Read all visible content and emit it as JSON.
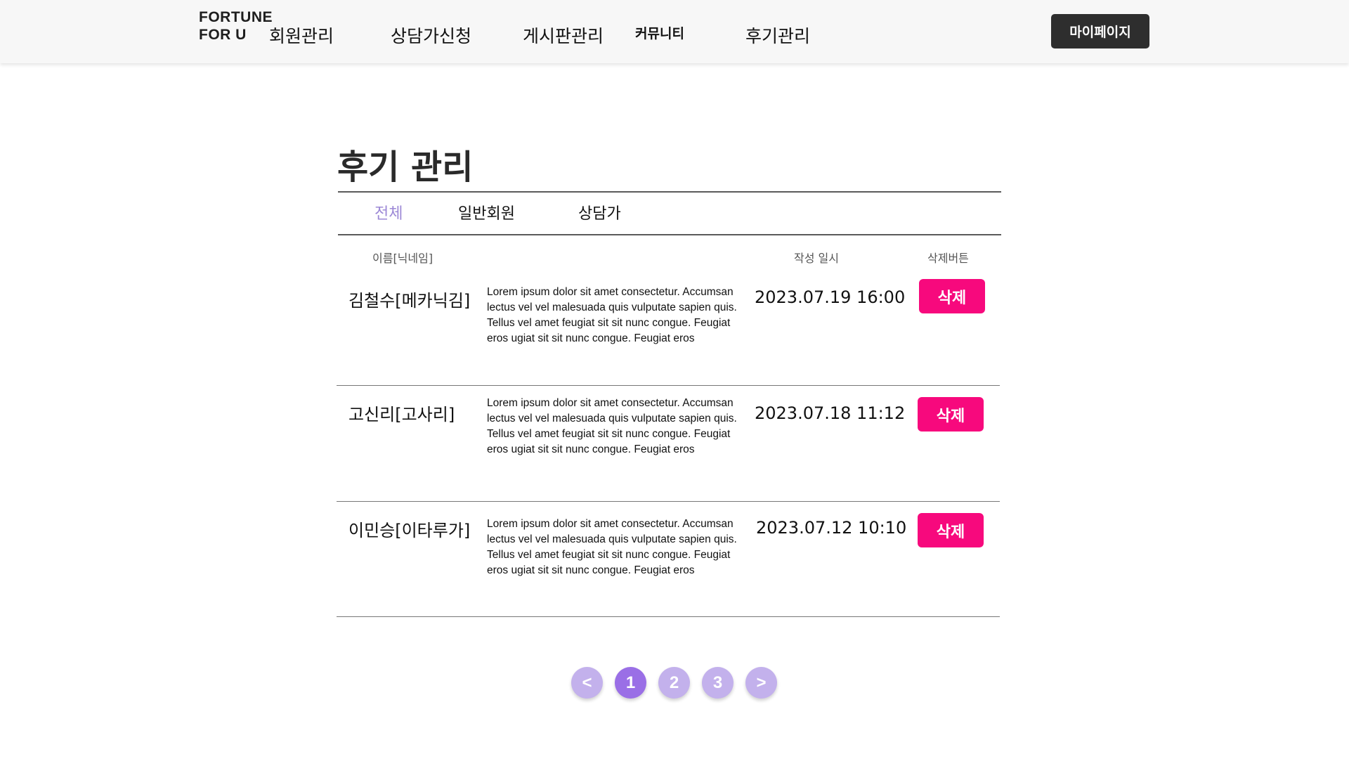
{
  "header": {
    "logo": "FORTUNE FOR U",
    "nav": [
      "회원관리",
      "상담가신청",
      "게시판관리",
      "커뮤니티",
      "후기관리"
    ],
    "mypage": "마이페이지"
  },
  "main": {
    "title": "후기 관리",
    "tabs": [
      "전체",
      "일반회원",
      "상담가"
    ],
    "active_tab": "전체",
    "columns": {
      "name": "이름[닉네임]",
      "date": "작성 일시",
      "delete": "삭제버튼"
    },
    "rows": [
      {
        "name": "김철수[메카닉김]",
        "content": "Lorem ipsum dolor sit amet consectetur. Accumsan lectus vel vel malesuada quis vulputate sapien quis. Tellus vel amet feugiat sit sit nunc congue. Feugiat eros ugiat sit sit nunc congue. Feugiat eros",
        "date": "2023.07.19 16:00",
        "delete": "삭제"
      },
      {
        "name": "고신리[고사리]",
        "content": "Lorem ipsum dolor sit amet consectetur. Accumsan lectus vel vel malesuada quis vulputate sapien quis. Tellus vel amet feugiat sit sit nunc congue. Feugiat eros ugiat sit sit nunc congue. Feugiat eros",
        "date": "2023.07.18 11:12",
        "delete": "삭제"
      },
      {
        "name": "이민승[이타루가]",
        "content": "Lorem ipsum dolor sit amet consectetur. Accumsan lectus vel vel malesuada quis vulputate sapien quis. Tellus vel amet feugiat sit sit nunc congue. Feugiat eros ugiat sit sit nunc congue. Feugiat eros",
        "date": "2023.07.12 10:10",
        "delete": "삭제"
      }
    ]
  },
  "pagination": {
    "prev": "<",
    "pages": [
      "1",
      "2",
      "3"
    ],
    "current": "1",
    "next": ">"
  },
  "colors": {
    "accent": "#9c88d6",
    "delete": "#f7097d",
    "page_current": "#9a6fe6",
    "page_other": "#c3b1ec",
    "dark_button": "#2e2e2e"
  }
}
